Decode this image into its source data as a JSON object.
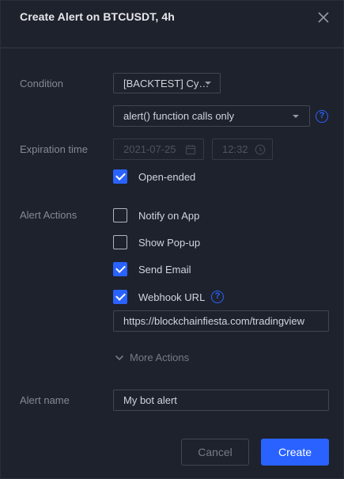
{
  "header": {
    "title": "Create Alert on BTCUSDT, 4h"
  },
  "condition": {
    "label": "Condition",
    "source_value": "[BACKTEST] Cy…",
    "trigger_value": "alert() function calls only"
  },
  "expiration": {
    "label": "Expiration time",
    "date": "2021-07-25",
    "time": "12:32",
    "open_ended_label": "Open-ended",
    "open_ended_checked": true
  },
  "actions": {
    "label": "Alert Actions",
    "items": [
      {
        "label": "Notify on App",
        "checked": false
      },
      {
        "label": "Show Pop-up",
        "checked": false
      },
      {
        "label": "Send Email",
        "checked": true
      },
      {
        "label": "Webhook URL",
        "checked": true
      }
    ],
    "webhook_url": "https://blockchainfiesta.com/tradingview",
    "more_label": "More Actions"
  },
  "alert_name": {
    "label": "Alert name",
    "value": "My bot alert"
  },
  "buttons": {
    "cancel": "Cancel",
    "create": "Create"
  },
  "colors": {
    "background": "#1e222d",
    "accent": "#2962ff",
    "border": "#434651",
    "label": "#868993"
  }
}
